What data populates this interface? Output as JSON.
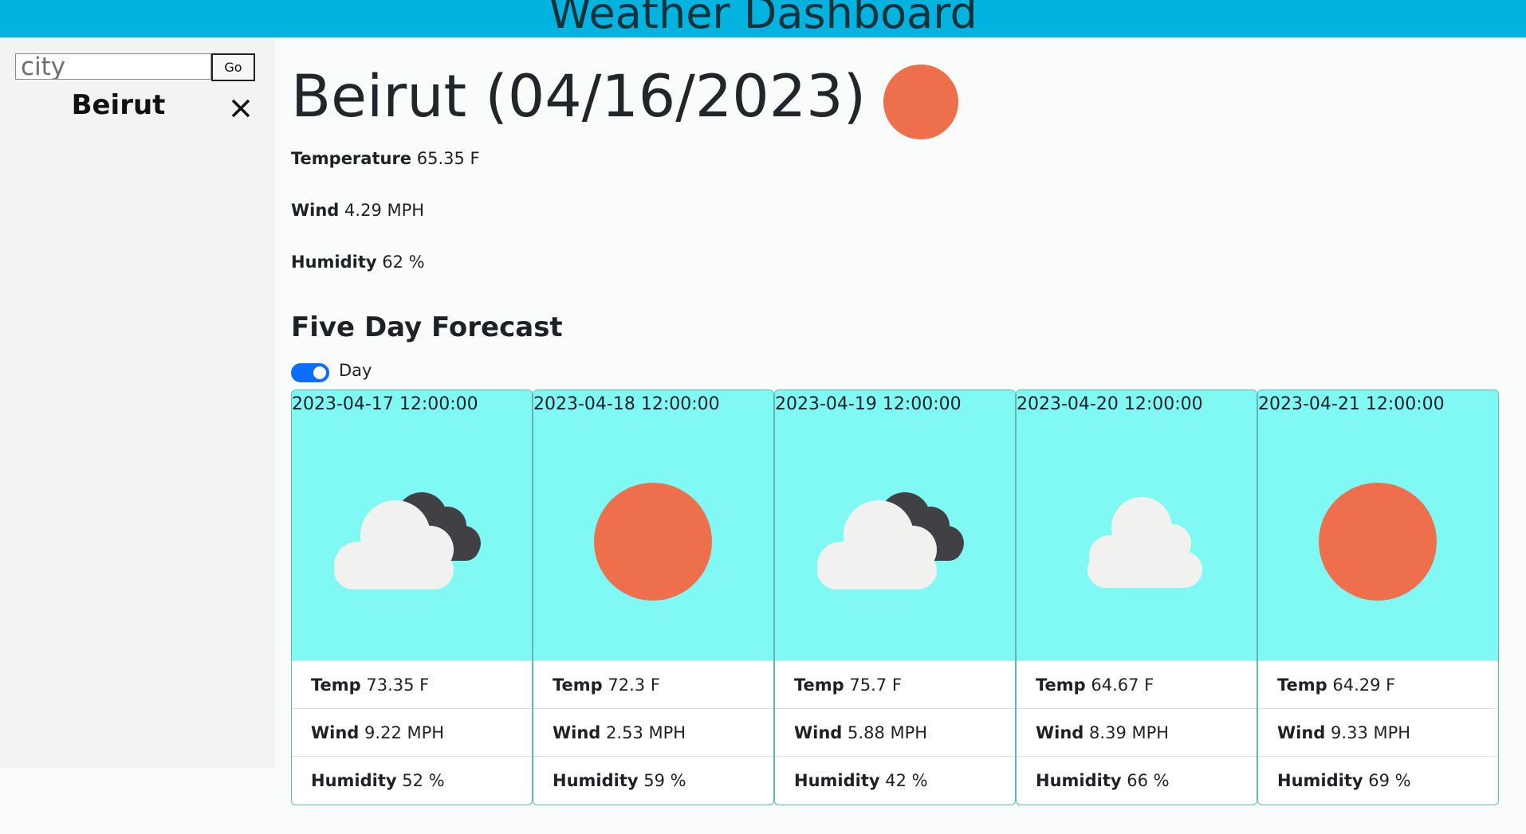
{
  "header": {
    "title": "Weather Dashboard"
  },
  "sidebar": {
    "search_placeholder": "city",
    "go_label": "Go",
    "history": [
      {
        "city": "Beirut"
      }
    ]
  },
  "current": {
    "title": "Beirut (04/16/2023)",
    "icon": "sun-icon",
    "temperature_label": "Temperature",
    "temperature_value": "65.35 F",
    "wind_label": "Wind",
    "wind_value": "4.29 MPH",
    "humidity_label": "Humidity",
    "humidity_value": "62 %"
  },
  "forecast": {
    "title": "Five Day Forecast",
    "toggle_label": "Day",
    "toggle_on": true,
    "temp_label": "Temp",
    "wind_label": "Wind",
    "humidity_label": "Humidity",
    "days": [
      {
        "date": "2023-04-17 12:00:00",
        "icon": "cloudy-icon",
        "temp": "73.35 F",
        "wind": "9.22 MPH",
        "humidity": "52 %"
      },
      {
        "date": "2023-04-18 12:00:00",
        "icon": "sun-icon",
        "temp": "72.3 F",
        "wind": "2.53 MPH",
        "humidity": "59 %"
      },
      {
        "date": "2023-04-19 12:00:00",
        "icon": "cloudy-icon",
        "temp": "75.7 F",
        "wind": "5.88 MPH",
        "humidity": "42 %"
      },
      {
        "date": "2023-04-20 12:00:00",
        "icon": "cloud-icon",
        "temp": "64.67 F",
        "wind": "8.39 MPH",
        "humidity": "66 %"
      },
      {
        "date": "2023-04-21 12:00:00",
        "icon": "sun-icon",
        "temp": "64.29 F",
        "wind": "9.33 MPH",
        "humidity": "69 %"
      }
    ]
  },
  "colors": {
    "header_bg": "#02b2df",
    "sun": "#ee6f4c",
    "card_top": "#80f8f4",
    "toggle": "#0d6efd"
  }
}
